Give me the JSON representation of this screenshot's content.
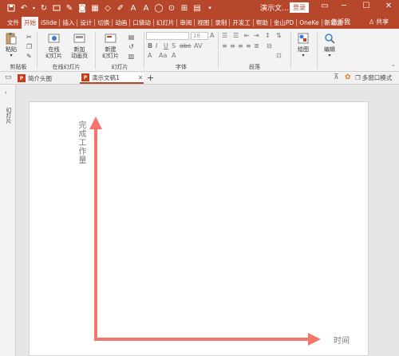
{
  "titlebar": {
    "doc_title": "演示文...",
    "login_label": "登录",
    "qat_icons": [
      "save-icon",
      "undo-icon",
      "redo-icon",
      "repeat-icon",
      "start-slideshow-icon"
    ]
  },
  "tabs": [
    "文件",
    "开始",
    "iSlide",
    "插入",
    "设计",
    "切换",
    "动画",
    "口袋动",
    "幻灯片",
    "审阅",
    "视图",
    "录制",
    "开发工",
    "帮助",
    "金山PD",
    "OneKe",
    "新建选"
  ],
  "active_tab": "开始",
  "tellme": {
    "label": "告诉我"
  },
  "share": {
    "label": "共享"
  },
  "ribbon": {
    "clipboard": {
      "paste": "粘贴",
      "label": "剪贴板"
    },
    "online": {
      "btn1_l1": "在线",
      "btn1_l2": "幻灯片",
      "btn2_l1": "新加",
      "btn2_l2": "动画页",
      "label": "在线幻灯片"
    },
    "slides": {
      "new_l1": "新建",
      "new_l2": "幻灯片",
      "label": "幻灯片"
    },
    "font": {
      "size": "18",
      "label": "字体",
      "b": "B",
      "i": "I",
      "u": "U",
      "s": "S",
      "abc": "abc",
      "av": "AV",
      "aa": "Aa"
    },
    "paragraph": {
      "label": "段落"
    },
    "drawing": {
      "label": "绘图"
    },
    "editing": {
      "label": "编辑"
    }
  },
  "doctabs": {
    "tab1": "简介头图",
    "tab2": "演示文稿1",
    "add": "+",
    "multi_window": "多窗口模式"
  },
  "leftstrip": {
    "label": "幻灯片"
  },
  "slide": {
    "y_axis_label": "完成工作量",
    "x_axis_label": "时间",
    "arrow_color": "#f4766a"
  },
  "colors": {
    "accent": "#b7472a",
    "arrow": "#f4766a"
  }
}
